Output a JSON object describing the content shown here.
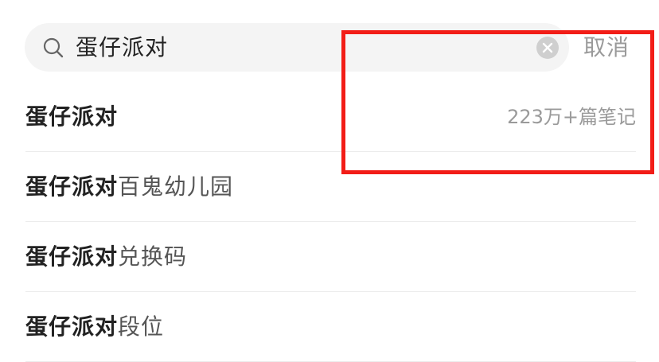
{
  "search": {
    "query": "蛋仔派对",
    "cancel_label": "取消"
  },
  "suggestions": [
    {
      "query": "蛋仔派对",
      "rest": "",
      "count": "223万+篇笔记"
    },
    {
      "query": "蛋仔派对",
      "rest": "百鬼幼儿园",
      "count": ""
    },
    {
      "query": "蛋仔派对",
      "rest": "兑换码",
      "count": ""
    },
    {
      "query": "蛋仔派对",
      "rest": "段位",
      "count": ""
    }
  ],
  "colors": {
    "annotation": "#f21d17",
    "search_bg": "#f4f4f4",
    "muted": "#9a9a9a"
  },
  "icons": {
    "search": "search-icon",
    "clear": "close-circle-icon"
  }
}
